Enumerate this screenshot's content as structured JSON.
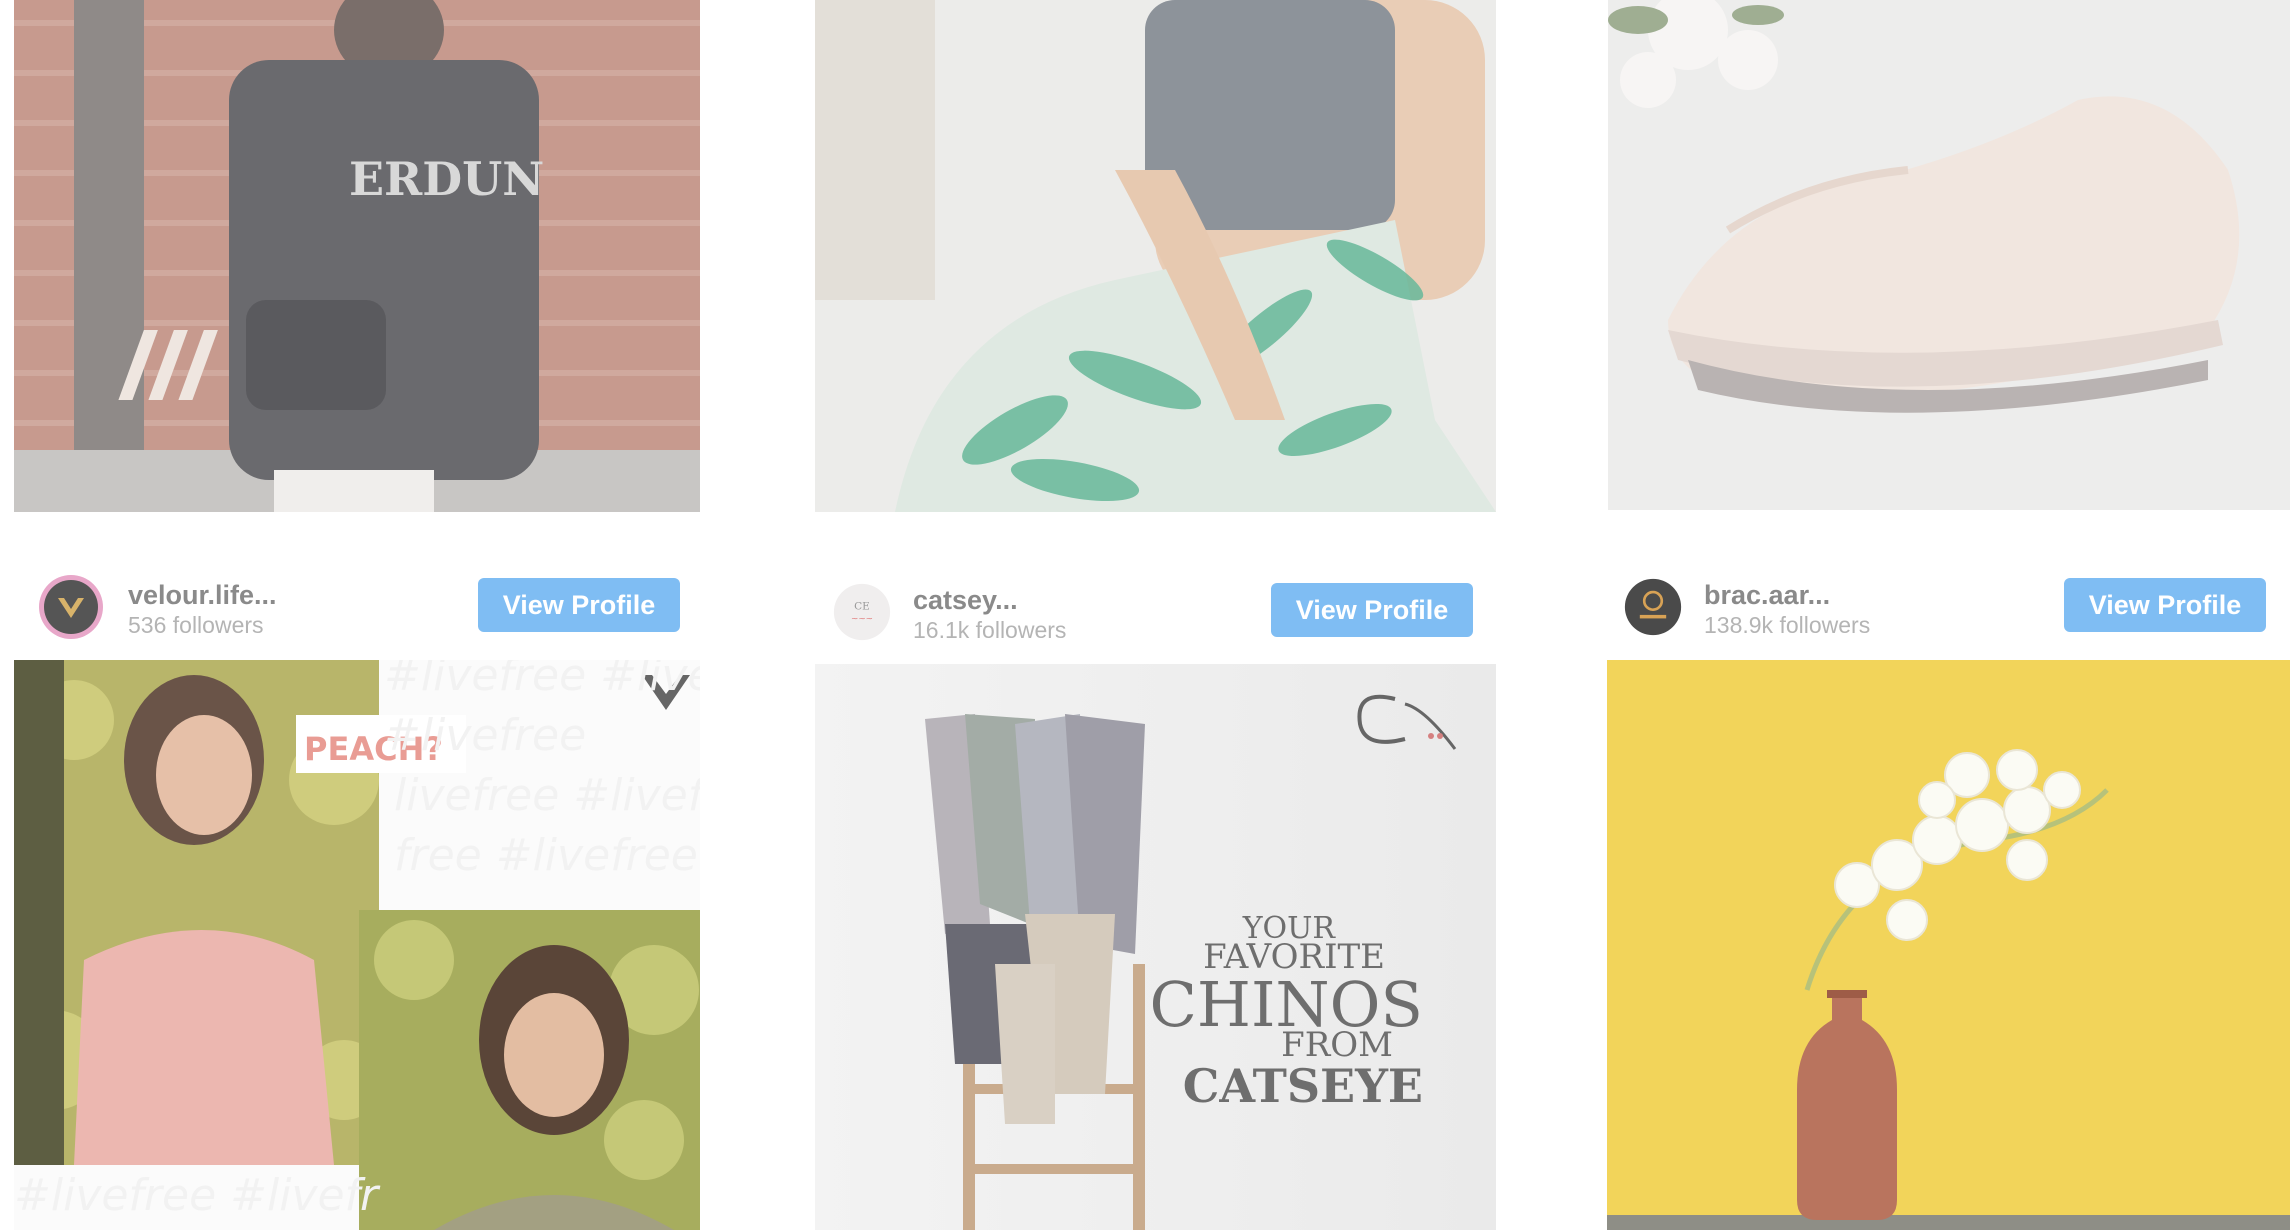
{
  "profiles": [
    {
      "name": "velour.life...",
      "followers": "536 followers",
      "button": "View Profile",
      "avatar_icon": "v-logo-icon"
    },
    {
      "name": "catsey...",
      "followers": "16.1k followers",
      "button": "View Profile",
      "avatar_icon": "catseye-logo-icon"
    },
    {
      "name": "brac.aar...",
      "followers": "138.9k followers",
      "button": "View Profile",
      "avatar_icon": "aarong-logo-icon"
    }
  ],
  "posts": {
    "velour": {
      "badge": "PEACH?"
    },
    "catseye": {
      "line1": "YOUR",
      "line2": "FAVORITE",
      "line3": "CHINOS",
      "line4": "FROM",
      "line5": "CATSEYE",
      "logo": "CE"
    },
    "top_tee_text": "ERDUN"
  },
  "colors": {
    "button": "#7fbdf3",
    "peach": "#e99c94",
    "yellow": "#f2d45a"
  }
}
